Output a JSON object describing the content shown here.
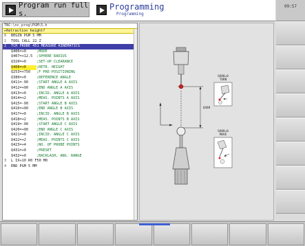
{
  "header": {
    "tab_run": "Program run full s.",
    "tab_prog_title": "Programming",
    "tab_prog_subtitle": "Programming",
    "time": "09:57"
  },
  "listing": {
    "path": "TNC:\\nc_prog\\PGM\\5.h",
    "prompt": "Retraction height?",
    "lines": [
      {
        "num": "0",
        "code": "BEGIN PGM 5 MM"
      },
      {
        "num": "1",
        "code": "TOOL CALL 22 Z"
      },
      {
        "num": "2",
        "code": "TCH PROBE 451 MEASURE KINEMATICS",
        "hl": true
      },
      {
        "num": "",
        "code": "Q406=+0",
        "cmt": ";MODE"
      },
      {
        "num": "",
        "code": "Q407=+12.5",
        "cmt": ";SPHERE RADIUS"
      },
      {
        "num": "",
        "code": "Q320=+0",
        "cmt": ";SET-UP CLEARANCE"
      },
      {
        "num": "",
        "code": "Q408=+0",
        "cmt": ";RETR. HEIGHT",
        "cur": true
      },
      {
        "num": "",
        "code": "Q253=+750",
        "cmt": ";F PRE-POSITIONING"
      },
      {
        "num": "",
        "code": "Q380=+0",
        "cmt": ";REFERENCE ANGLE"
      },
      {
        "num": "",
        "code": "Q411=-90",
        "cmt": ";START ANGLE A AXIS"
      },
      {
        "num": "",
        "code": "Q412=+90",
        "cmt": ";END ANGLE A AXIS"
      },
      {
        "num": "",
        "code": "Q413=+0",
        "cmt": ";INCID. ANGLE A AXIS"
      },
      {
        "num": "",
        "code": "Q414=+2",
        "cmt": ";MEAS. POINTS A AXIS"
      },
      {
        "num": "",
        "code": "Q415=-90",
        "cmt": ";START ANGLE B AXIS"
      },
      {
        "num": "",
        "code": "Q416=+90",
        "cmt": ";END ANGLE B AXIS"
      },
      {
        "num": "",
        "code": "Q417=+0",
        "cmt": ";INCID. ANGLE B AXIS"
      },
      {
        "num": "",
        "code": "Q418=+2",
        "cmt": ";MEAS. POINTS B AXIS"
      },
      {
        "num": "",
        "code": "Q419=-90",
        "cmt": ";START ANGLE C AXIS"
      },
      {
        "num": "",
        "code": "Q420=+90",
        "cmt": ";END ANGLE C AXIS"
      },
      {
        "num": "",
        "code": "Q421=+0",
        "cmt": ";INCID. ANGLE C AXIS"
      },
      {
        "num": "",
        "code": "Q422=+2",
        "cmt": ";MEAS. POINTS C AXIS"
      },
      {
        "num": "",
        "code": "Q423=+4",
        "cmt": ";NO. OF PROBE POINTS"
      },
      {
        "num": "",
        "code": "Q431=+0",
        "cmt": ";PRESET"
      },
      {
        "num": "",
        "code": "Q432=+0",
        "cmt": ";BACKLASH, ANG. RANGE"
      },
      {
        "num": "3",
        "code": "L IX+10 R0 F50 M0"
      },
      {
        "num": "4",
        "code": "END PGM 5 MM"
      }
    ]
  },
  "graphic": {
    "label_turn_q": "Q408=0",
    "label_turn": "TURN",
    "label_height": "Q408",
    "label_move_q": "Q408=0",
    "label_move": "MOVE"
  }
}
